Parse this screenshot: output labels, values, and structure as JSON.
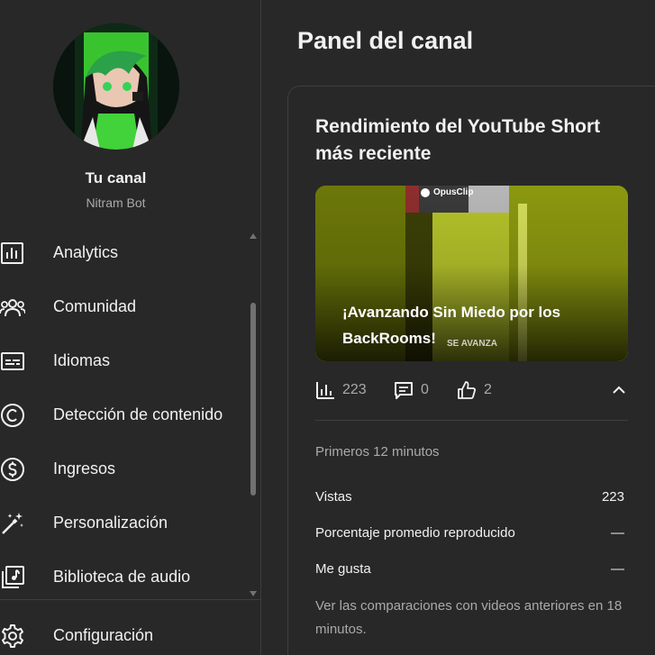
{
  "channel": {
    "name": "Tu canal",
    "handle": "Nitram Bot"
  },
  "nav": {
    "items": [
      {
        "label": "Analytics",
        "icon": "analytics-icon"
      },
      {
        "label": "Comunidad",
        "icon": "community-icon"
      },
      {
        "label": "Idiomas",
        "icon": "subtitles-icon"
      },
      {
        "label": "Detección de contenido",
        "icon": "copyright-icon"
      },
      {
        "label": "Ingresos",
        "icon": "dollar-icon"
      },
      {
        "label": "Personalización",
        "icon": "magic-wand-icon"
      },
      {
        "label": "Biblioteca de audio",
        "icon": "audio-library-icon"
      }
    ],
    "settings_label": "Configuración"
  },
  "main": {
    "title": "Panel del canal",
    "card": {
      "title": "Rendimiento del YouTube Short más reciente",
      "thumbnail": {
        "title": "¡Avanzando Sin Miedo por los BackRooms!",
        "watermark": "OpusClip",
        "overlay_text": "SE AVANZA"
      },
      "stats": {
        "views": "223",
        "comments": "0",
        "likes": "2"
      },
      "period": "Primeros 12 minutos",
      "metrics": [
        {
          "label": "Vistas",
          "value": "223"
        },
        {
          "label": "Porcentaje promedio reproducido",
          "value": "—"
        },
        {
          "label": "Me gusta",
          "value": "—"
        }
      ],
      "compare_note": "Ver las comparaciones con videos anteriores en 18 minutos."
    }
  },
  "colors": {
    "background": "#282828",
    "text": "#f1f1f1",
    "secondary_text": "#aaaaaa",
    "accent_green": "#8bd11e"
  }
}
